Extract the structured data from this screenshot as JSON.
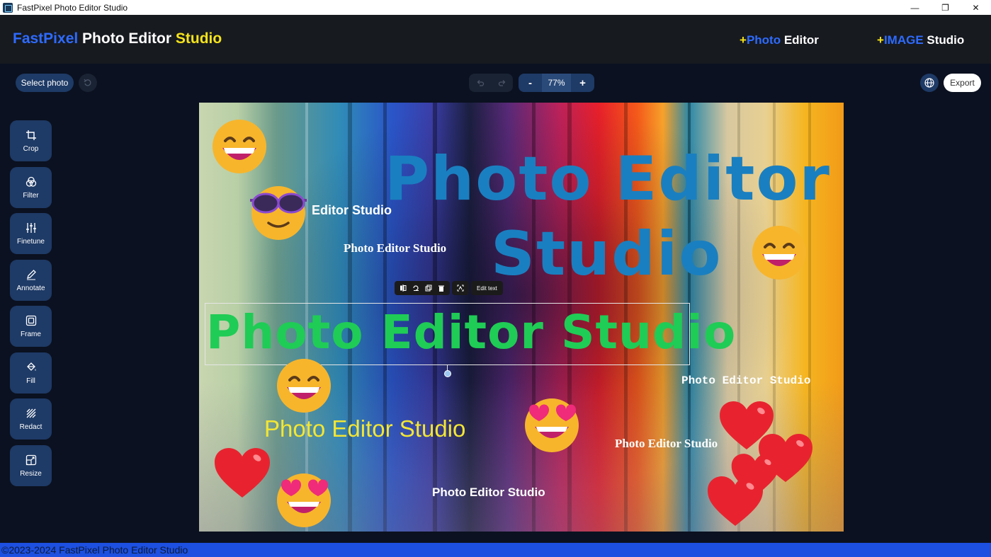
{
  "window": {
    "title": "FastPixel Photo Editor Studio",
    "controls": [
      "—",
      "❐",
      "✕"
    ]
  },
  "header": {
    "brand": {
      "part1": "FastPixel",
      "part2": " Photo Editor ",
      "part3": "Studio"
    },
    "nav": [
      {
        "plus": "+",
        "highlight": "Photo",
        "rest": " Editor"
      },
      {
        "plus": "+",
        "highlight": "IMAGE",
        "rest": " Studio"
      }
    ]
  },
  "toolbar": {
    "select_photo": "Select photo",
    "zoom_out": "-",
    "zoom_value": "77%",
    "zoom_in": "+",
    "export": "Export"
  },
  "tools": [
    {
      "label": "Crop",
      "icon": "crop-icon"
    },
    {
      "label": "Filter",
      "icon": "filter-icon"
    },
    {
      "label": "Finetune",
      "icon": "finetune-icon"
    },
    {
      "label": "Annotate",
      "icon": "annotate-icon"
    },
    {
      "label": "Frame",
      "icon": "frame-icon"
    },
    {
      "label": "Fill",
      "icon": "fill-icon"
    },
    {
      "label": "Redact",
      "icon": "redact-icon"
    },
    {
      "label": "Resize",
      "icon": "resize-icon"
    }
  ],
  "canvas": {
    "big_title": "Photo Editor",
    "big_title2": "Studio",
    "selected_text": "Photo Editor Studio",
    "small1": "Editor Studio",
    "small2": "Photo Editor Studio",
    "yellow_text": "Photo Editor Studio",
    "mono_text": "Photo Editor Studio",
    "serif_right": "Photo Editor Studio",
    "bottom_text": "Photo Editor Studio",
    "edit_text": "Edit text"
  },
  "colors": {
    "accent_blue": "#2e6bff",
    "accent_yellow": "#f5e31b",
    "tool_bg": "#1e3a66",
    "footer": "#1d4fe0"
  },
  "footer": {
    "text": "©2023-2024 FastPixel Photo Editor Studio"
  }
}
